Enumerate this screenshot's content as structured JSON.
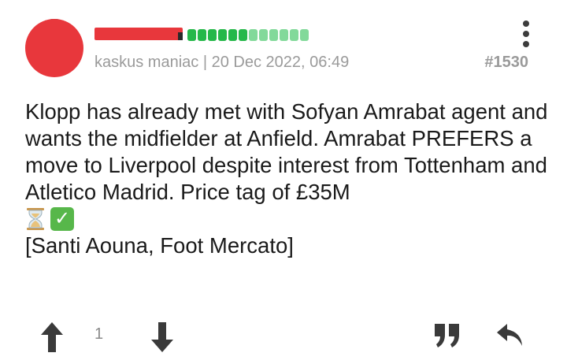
{
  "post": {
    "author_rank": "kaskus maniac",
    "date_separator": "|",
    "date": "20 Dec 2022, 06:49",
    "post_number": "#1530",
    "reputation": {
      "filled": 6,
      "total": 12
    },
    "body": {
      "paragraph": "Klopp has already met with Sofyan Amrabat agent and wants the midfielder at Anfield. Amrabat PREFERS a move to Liverpool despite interest from Tottenham and Atletico Madrid. Price tag of £35M",
      "emoji": [
        "hourglass-icon",
        "check-mark-icon"
      ],
      "source": "[Santi Aouna, Foot Mercato]"
    },
    "votes": {
      "count": "1"
    }
  },
  "colors": {
    "redaction": "#e8373c",
    "rep_on": "#25b84a",
    "rep_off": "#82d99a",
    "meta_text": "#9a9a9a",
    "icon": "#3a3a3a"
  }
}
